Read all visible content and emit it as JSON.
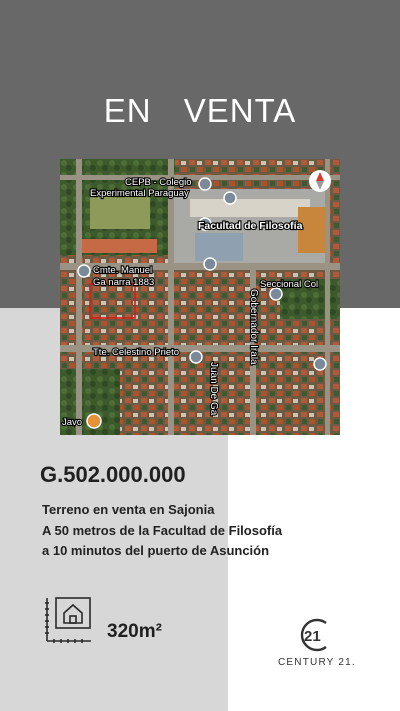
{
  "headline": "EN VENTA",
  "map": {
    "labels": {
      "school_line1": "CEPB - Colegio",
      "school_line2": "Experimental Paraguay",
      "faculty": "Facultad de Filosofía",
      "cmte_line1": "Cmte. Manuel",
      "cmte_line2": "Ga narra 1883",
      "gobernador": "Gobernador Irala",
      "seccional": "Seccional Col",
      "celestino": "Tte. Celestino Prieto",
      "juan": "Juan De Ga",
      "javo": "Javo"
    }
  },
  "price": "G.502.000.000",
  "description": [
    "Terreno en venta en Sajonia",
    "A 50 metros de la Facultad de Filosofía",
    "a 10 minutos del puerto de Asunción"
  ],
  "area": "320m²",
  "brand": {
    "logo_mark": "21",
    "name": "CENTURY 21."
  },
  "icons": {
    "area": "floor-plan-house-icon",
    "compass": "compass-icon"
  }
}
